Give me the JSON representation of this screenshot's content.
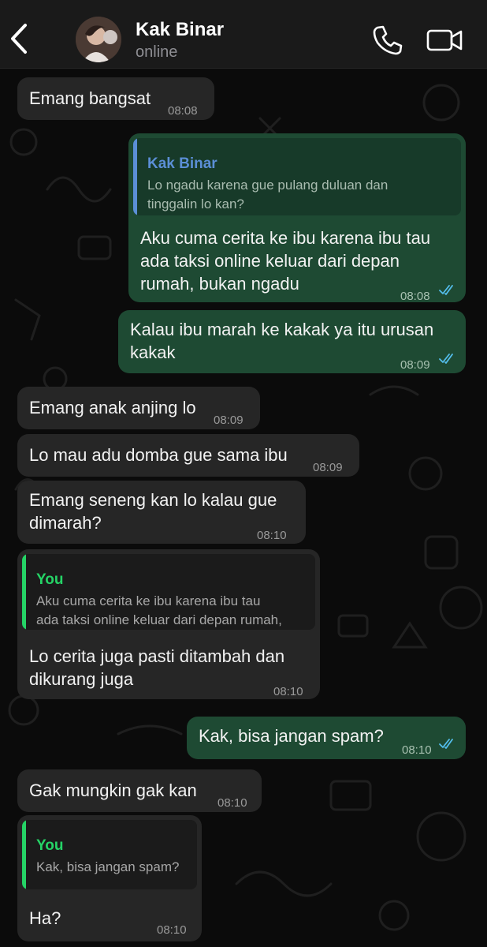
{
  "header": {
    "contact_name": "Kak Binar",
    "status": "online",
    "back_icon": "chevron-left-icon",
    "call_icon": "phone-icon",
    "video_icon": "video-camera-icon"
  },
  "colors": {
    "incoming_bubble": "#262626",
    "outgoing_bubble": "#1e4a33",
    "read_ticks": "#53bdeb",
    "quote_you": "#25d366",
    "quote_contact": "#5b8fd6"
  },
  "messages": [
    {
      "direction": "incoming",
      "text": "Emang bangsat",
      "time": "08:08"
    },
    {
      "direction": "outgoing",
      "reply_to": {
        "author": "Kak Binar",
        "text": "Lo ngadu karena gue pulang duluan dan\ntinggalin lo kan?"
      },
      "text": "Aku cuma cerita ke ibu karena ibu tau\nada taksi online keluar dari depan\nrumah, bukan ngadu",
      "time": "08:08",
      "read": true
    },
    {
      "direction": "outgoing",
      "text": "Kalau ibu marah ke kakak ya itu urusan\nkakak",
      "time": "08:09",
      "read": true
    },
    {
      "direction": "incoming",
      "text": "Emang anak anjing lo",
      "time": "08:09"
    },
    {
      "direction": "incoming",
      "text": "Lo mau adu domba gue sama ibu",
      "time": "08:09"
    },
    {
      "direction": "incoming",
      "text": "Emang seneng kan lo kalau gue\ndimarah?",
      "time": "08:10"
    },
    {
      "direction": "incoming",
      "reply_to": {
        "author": "You",
        "text": "Aku cuma cerita ke ibu karena ibu tau\nada taksi online keluar dari depan rumah,"
      },
      "text": "Lo cerita juga pasti ditambah dan\ndikurang juga",
      "time": "08:10"
    },
    {
      "direction": "outgoing",
      "text": "Kak, bisa jangan spam?",
      "time": "08:10",
      "read": true
    },
    {
      "direction": "incoming",
      "text": "Gak mungkin gak kan",
      "time": "08:10"
    },
    {
      "direction": "incoming",
      "reply_to": {
        "author": "You",
        "text": "Kak, bisa jangan spam?"
      },
      "text": "Ha?",
      "time": "08:10"
    }
  ]
}
